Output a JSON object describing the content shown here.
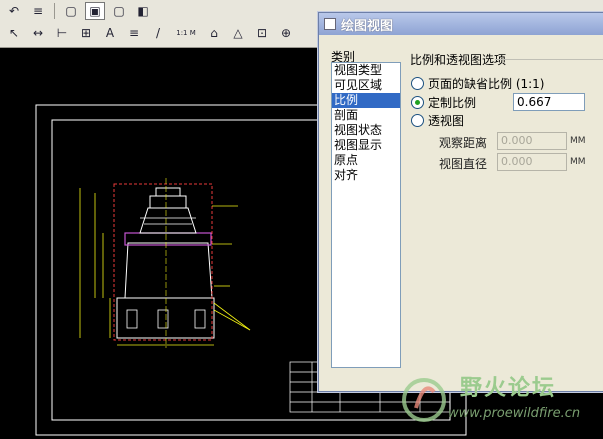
{
  "toolbar": {
    "row1": [
      "undo-icon",
      "layers-icon",
      "view-box-icon",
      "view-box-front-icon",
      "view-box-side-icon",
      "view-box-shaded-icon"
    ],
    "row2_texts": {
      "scale": "1:1 M"
    }
  },
  "dialog": {
    "title": "绘图视图",
    "category_label": "类别",
    "categories": [
      "视图类型",
      "可见区域",
      "比例",
      "剖面",
      "视图状态",
      "视图显示",
      "原点",
      "对齐"
    ],
    "selected_category": "比例",
    "group_title": "比例和透视图选项",
    "options": {
      "default_scale": "页面的缺省比例 (1:1)",
      "custom_scale": "定制比例",
      "perspective": "透视图"
    },
    "selected_option": "custom_scale",
    "custom_scale_value": "0.667",
    "view_distance_label": "观察距离",
    "view_distance_value": "0.000",
    "view_diameter_label": "视图直径",
    "view_diameter_value": "0.000",
    "unit": "MM"
  },
  "watermark": {
    "title": "野火论坛",
    "url": "www.proewildfire.cn"
  },
  "colors": {
    "drawing_line": "#ffffff",
    "dimension": "#f2f214",
    "highlight": "#e83a3a",
    "selected_item": "#316ac5"
  }
}
